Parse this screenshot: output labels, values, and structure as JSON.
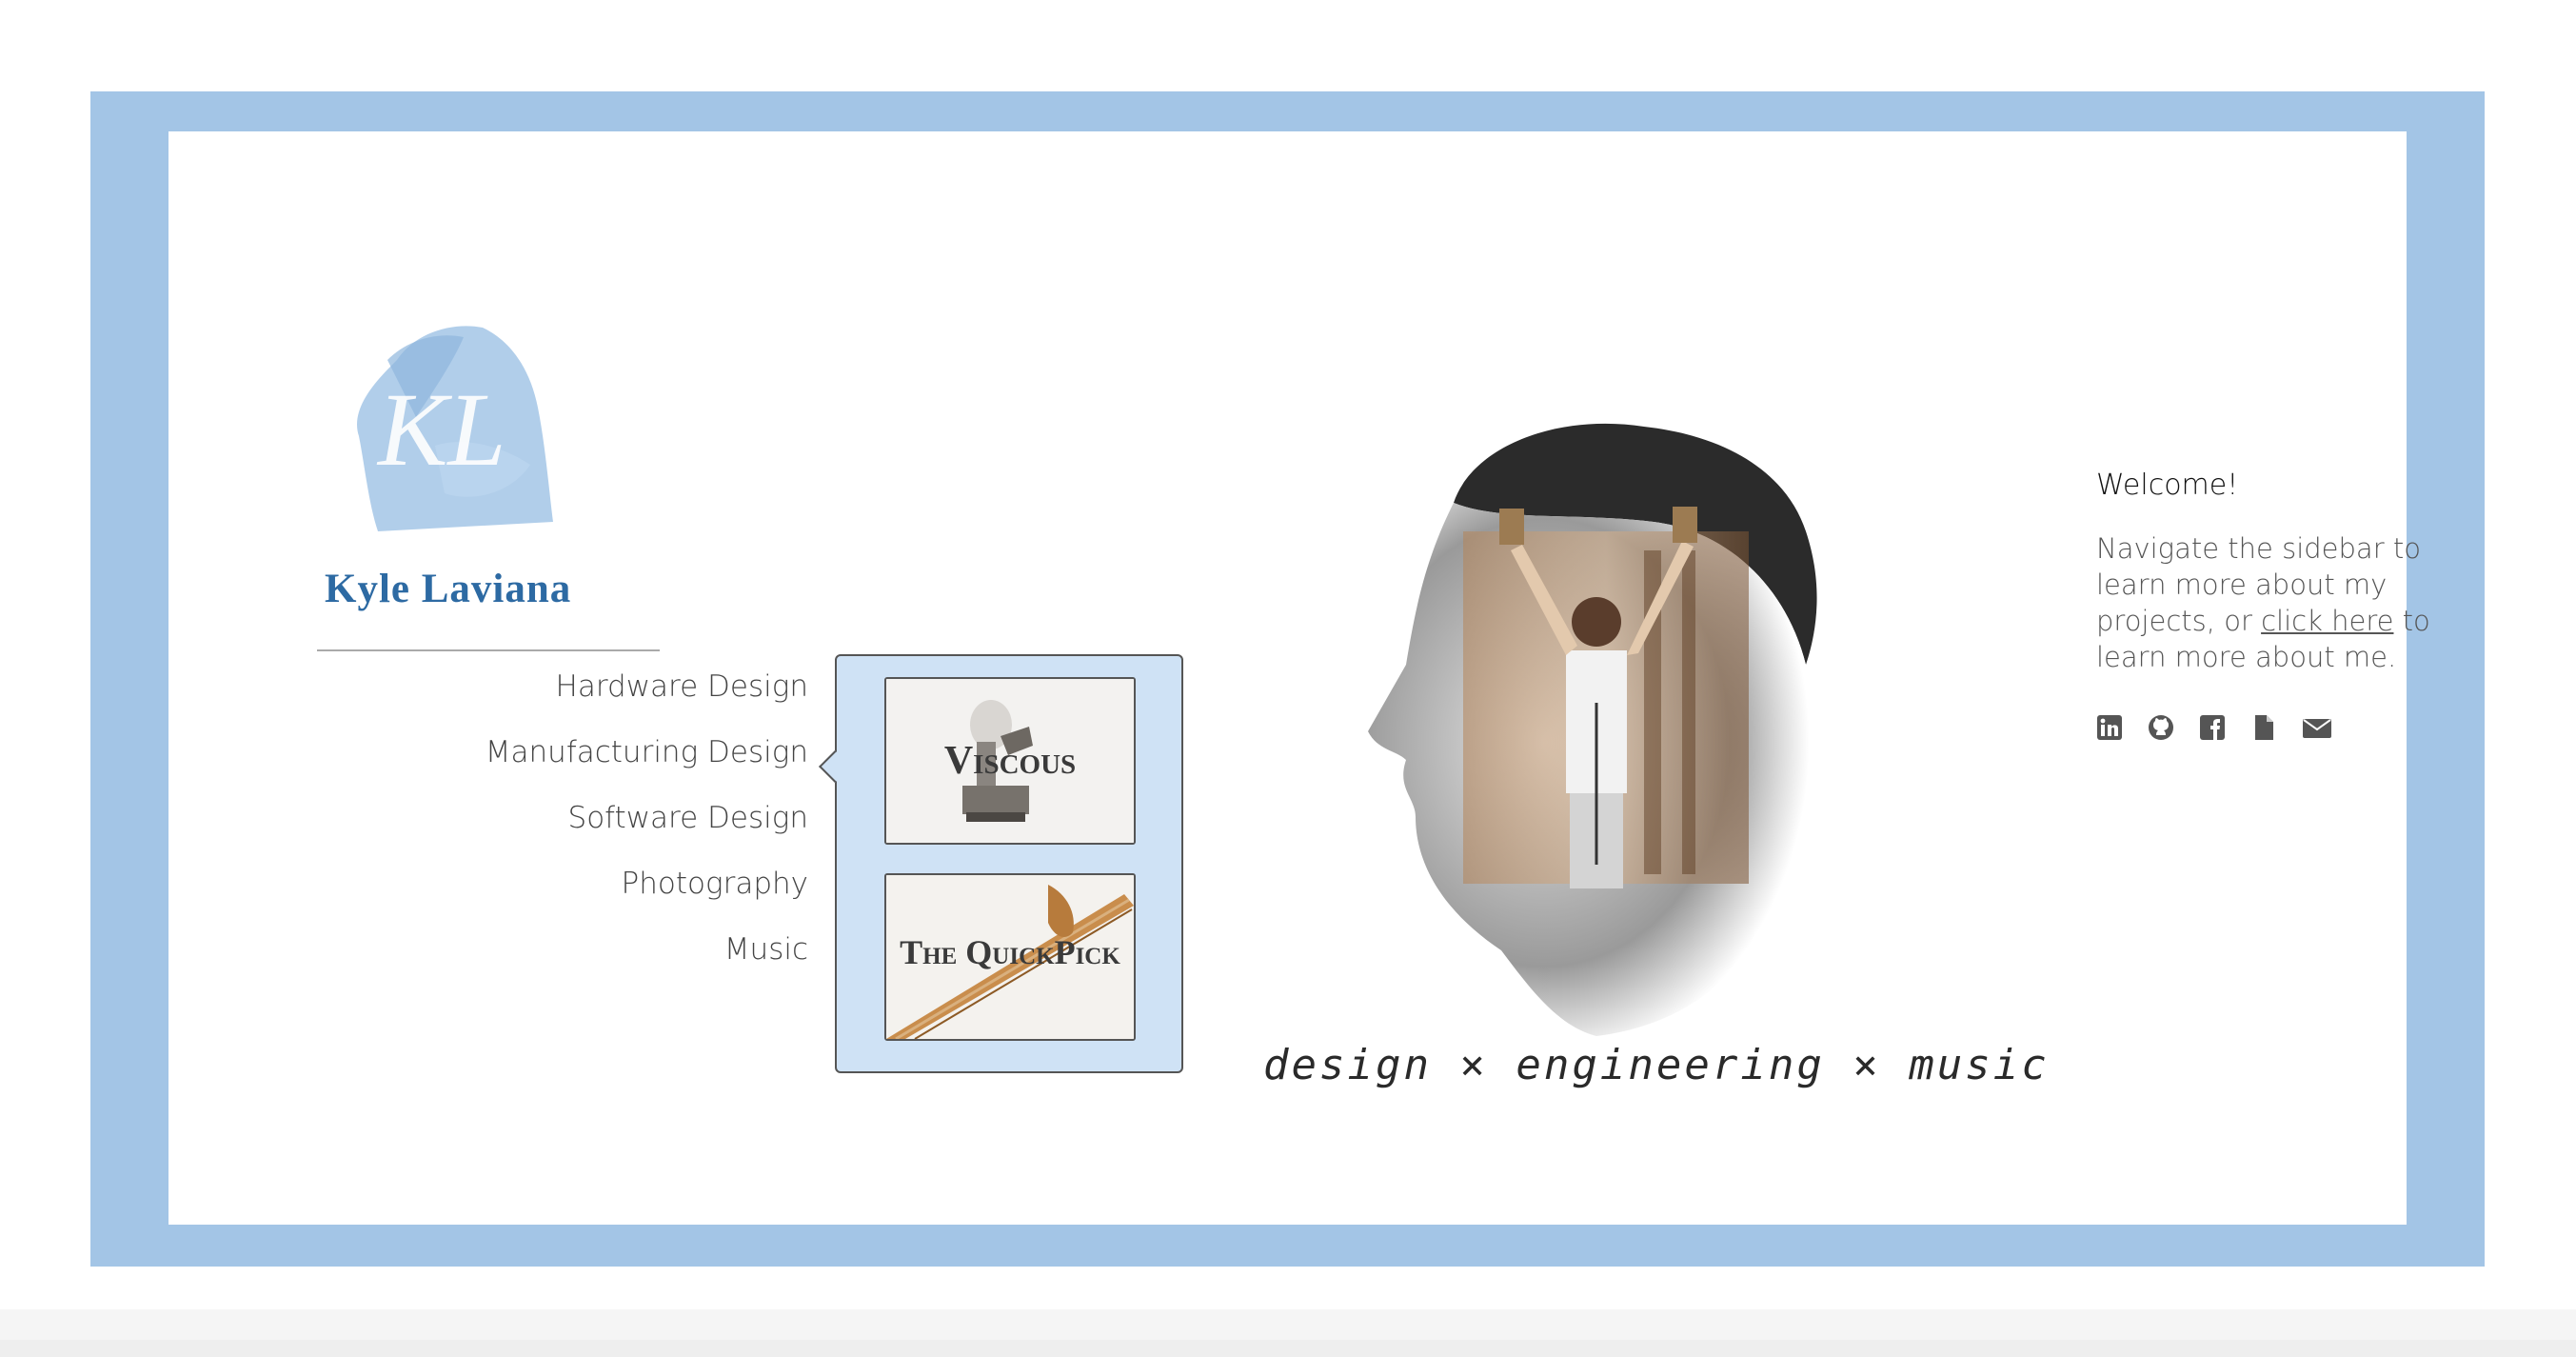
{
  "brand": {
    "name": "Kyle Laviana",
    "logo_initials": "KL",
    "accent_color": "#a3c5e6",
    "logo_color": "#2d6aa3"
  },
  "nav": {
    "items": [
      {
        "label": "Hardware Design"
      },
      {
        "label": "Manufacturing Design"
      },
      {
        "label": "Software Design"
      },
      {
        "label": "Photography"
      },
      {
        "label": "Music"
      }
    ],
    "active_index": 1
  },
  "submenu": {
    "cards": [
      {
        "label": "Viscous"
      },
      {
        "label": "The QuickPick"
      }
    ]
  },
  "hero": {
    "tagline": "design × engineering × music"
  },
  "welcome": {
    "title": "Welcome!",
    "body_before": "Navigate the sidebar to learn more about my projects, or ",
    "link": "click here",
    "body_after": " to learn more about me."
  },
  "social": {
    "icons": [
      "linkedin-icon",
      "github-icon",
      "facebook-icon",
      "document-icon",
      "envelope-icon"
    ]
  }
}
